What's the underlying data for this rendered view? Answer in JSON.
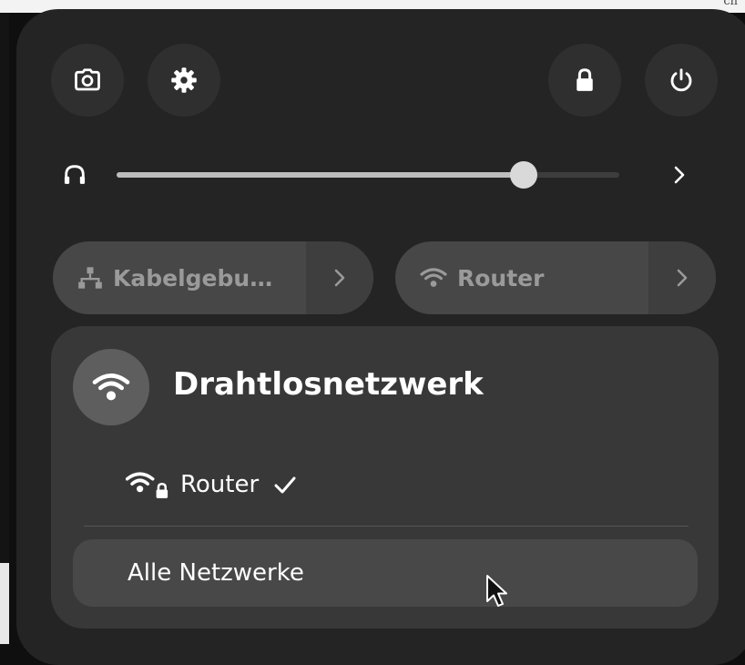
{
  "background": {
    "corner_text": "ch"
  },
  "top_buttons": {
    "screenshot": "camera-icon",
    "settings": "gear-icon",
    "lock": "lock-icon",
    "power": "power-icon"
  },
  "volume": {
    "icon": "headphones-icon",
    "level": 0.81
  },
  "quick_toggles": {
    "wired": {
      "label": "Kabelgebu…",
      "icon": "network-wired-icon"
    },
    "wifi": {
      "label": "Router",
      "icon": "wifi-icon"
    }
  },
  "wifi_menu": {
    "title": "Drahtlosnetzwerk",
    "networks": [
      {
        "name": "Router",
        "connected": true
      }
    ],
    "all_networks_label": "Alle Netzwerke"
  },
  "colors": {
    "panel": "#242424",
    "menu": "#383838",
    "toggle": "#474747",
    "accent_fill": "#bdbdbd"
  }
}
